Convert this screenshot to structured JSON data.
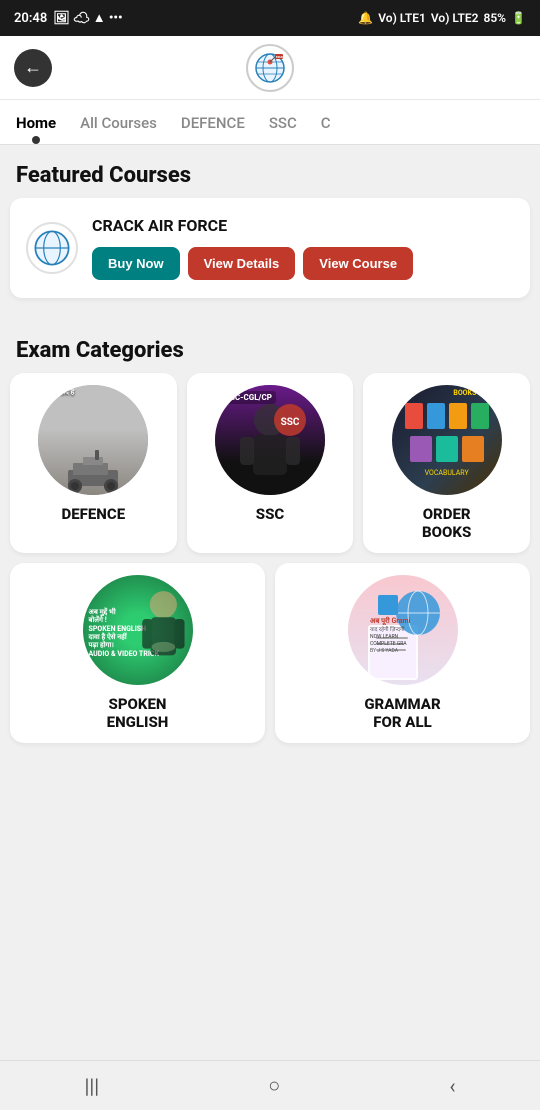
{
  "statusBar": {
    "time": "20:48",
    "battery": "85%"
  },
  "header": {
    "backLabel": "←"
  },
  "navTabs": [
    {
      "id": "home",
      "label": "Home",
      "active": true
    },
    {
      "id": "allcourses",
      "label": "All Courses",
      "active": false
    },
    {
      "id": "defence",
      "label": "DEFENCE",
      "active": false
    },
    {
      "id": "ssc",
      "label": "SSC",
      "active": false
    },
    {
      "id": "other",
      "label": "...",
      "active": false
    }
  ],
  "featuredSection": {
    "title": "Featured Courses",
    "card": {
      "courseTitle": "CRACK AIR FORCE",
      "buyNowLabel": "Buy Now",
      "viewDetailsLabel": "View Details",
      "viewCourseLabel": "View Course"
    }
  },
  "examCategories": {
    "title": "Exam Categories",
    "topRow": [
      {
        "id": "defence",
        "label": "DEFENCE",
        "imgType": "defence"
      },
      {
        "id": "ssc",
        "label": "SSC",
        "imgType": "ssc"
      },
      {
        "id": "orderbooks",
        "label": "ORDER\nBOOKS",
        "imgType": "books"
      }
    ],
    "bottomRow": [
      {
        "id": "spokenenglish",
        "label": "SPOKEN\nENGLISH",
        "imgType": "english"
      },
      {
        "id": "grammarforall",
        "label": "GRAMMAR\nFOR ALL",
        "imgType": "grammar"
      }
    ]
  },
  "bottomNav": {
    "items": [
      "|||",
      "○",
      "<"
    ]
  }
}
